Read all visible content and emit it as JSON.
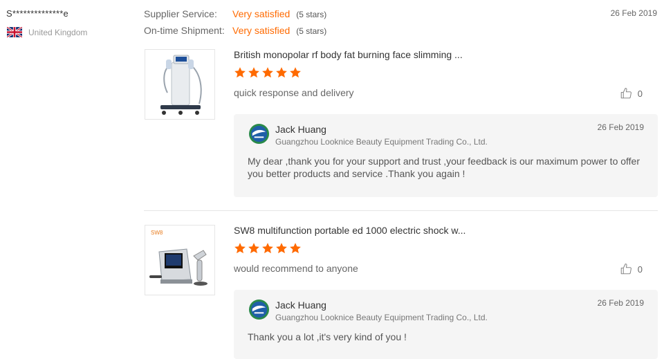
{
  "reviewer": {
    "name": "S**************e",
    "country": "United Kingdom",
    "flag_icon": "uk-flag-icon"
  },
  "ratings": [
    {
      "label": "Supplier Service:",
      "value": "Very satisfied",
      "stars_text": "(5 stars)"
    },
    {
      "label": "On-time Shipment:",
      "value": "Very satisfied",
      "stars_text": "(5 stars)"
    }
  ],
  "review_date": "26 Feb 2019",
  "colors": {
    "accent": "#ff6a00",
    "reply_bg": "#f5f5f5"
  },
  "items": [
    {
      "product_title": "British monopolar rf body fat burning face slimming ...",
      "rating": 5,
      "comment": "quick response and delivery",
      "likes": "0",
      "reply": {
        "name": "Jack Huang",
        "company": "Guangzhou Looknice Beauty Equipment Trading Co., Ltd.",
        "date": "26 Feb 2019",
        "text": "My dear ,thank you for your support and trust ,your feedback is our maximum power to offer you better products and service .Thank you again !"
      }
    },
    {
      "product_title": "SW8 multifunction portable ed 1000 electric shock w...",
      "image_label": "SW8",
      "rating": 5,
      "comment": "would recommend to anyone",
      "likes": "0",
      "reply": {
        "name": "Jack Huang",
        "company": "Guangzhou Looknice Beauty Equipment Trading Co., Ltd.",
        "date": "26 Feb 2019",
        "text": "Thank you a lot ,it's very kind of you !"
      }
    }
  ]
}
